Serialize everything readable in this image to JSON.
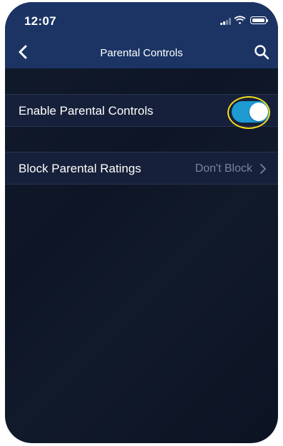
{
  "status_bar": {
    "time": "12:07"
  },
  "nav": {
    "title": "Parental Controls",
    "back_icon": "chevron-left-icon",
    "search_icon": "search-icon"
  },
  "settings": {
    "enable_parental_controls": {
      "label": "Enable Parental Controls",
      "enabled": true
    },
    "block_parental_ratings": {
      "label": "Block Parental Ratings",
      "value": "Don't Block"
    }
  },
  "colors": {
    "header_bg": "#1b3464",
    "page_bg": "#0f1828",
    "row_bg": "#16203a",
    "toggle_on": "#1e9bd3",
    "highlight": "#f2dc1c",
    "muted_text": "#7a8399"
  }
}
